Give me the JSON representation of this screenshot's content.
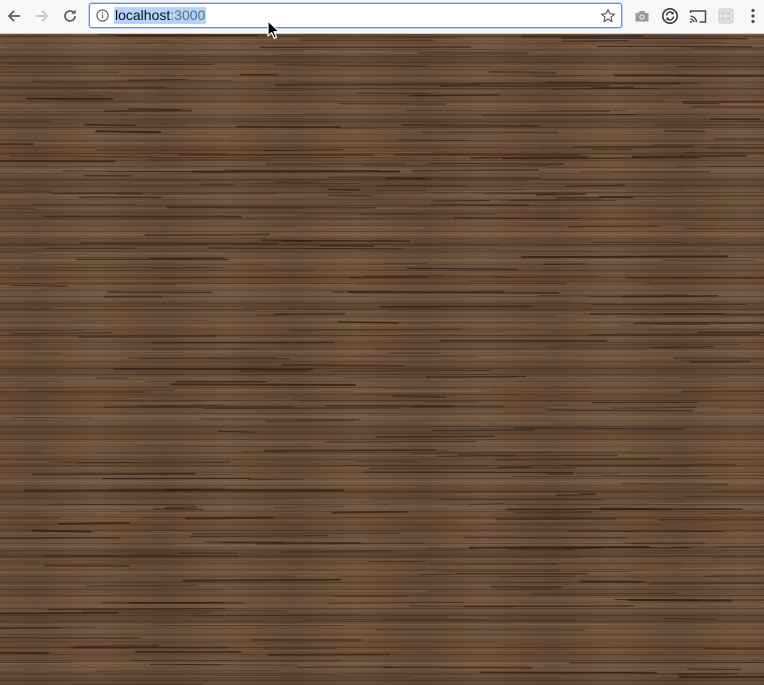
{
  "window": {
    "type": "browser"
  },
  "toolbar": {
    "back_icon": "arrow-left-icon",
    "forward_icon": "arrow-right-icon",
    "reload_icon": "reload-icon",
    "omnibox": {
      "host": "localhost",
      "port": ":3000",
      "selected": true,
      "info_icon": "info-icon",
      "bookmark_icon": "star-icon",
      "selection_color": "#b3d4fc",
      "focus_color": "#4d90fe"
    },
    "extensions": [
      {
        "icon": "camera-icon"
      },
      {
        "icon": "sync-icon"
      },
      {
        "icon": "cast-icon"
      },
      {
        "icon": "grid-extension-icon"
      }
    ],
    "menu_icon": "kebab-menu-icon"
  },
  "page": {
    "background": "wood-texture",
    "base_color": "#654a35",
    "dark_grain_color": "#2e1c10",
    "light_grain_color": "#8a6a4f"
  }
}
